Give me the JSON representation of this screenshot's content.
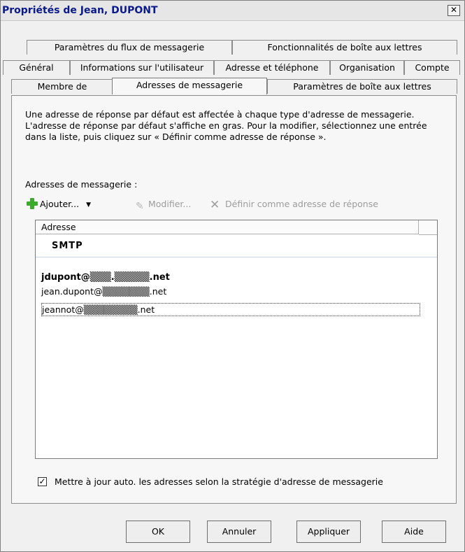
{
  "window": {
    "title": "Propriétés de Jean, DUPONT",
    "close": "✕"
  },
  "tabs": {
    "row1": [
      "Paramètres du flux de messagerie",
      "Fonctionnalités de boîte aux lettres"
    ],
    "row2": [
      "Général",
      "Informations sur l'utilisateur",
      "Adresse et téléphone",
      "Organisation",
      "Compte"
    ],
    "row3": [
      "Membre de",
      "Adresses de messagerie",
      "Paramètres de boîte aux lettres"
    ],
    "active": "Adresses de messagerie"
  },
  "content": {
    "info_text": "Une adresse de réponse par défaut est affectée à chaque type d'adresse de messagerie. L'adresse de réponse par défaut s'affiche en gras. Pour la modifier, sélectionnez une entrée dans la liste, puis cliquez sur « Définir comme adresse de réponse ».",
    "addresses_label": "Adresses de messagerie :",
    "toolbar": {
      "add": "Ajouter...",
      "edit": "Modifier...",
      "set_reply": "Définir comme adresse de réponse"
    },
    "list": {
      "column_header": "Adresse",
      "group": "SMTP",
      "rows": [
        "jdupont@▒▒▒.▒▒▒▒▒.net",
        "jean.dupont@▒▒▒▒▒▒▒.net",
        "jeannot@▒▒▒▒▒▒▒▒.net"
      ]
    },
    "checkbox": {
      "checked": true,
      "mark": "✓",
      "label": "Mettre à jour auto. les adresses selon la stratégie d'adresse de messagerie"
    }
  },
  "buttons": {
    "ok": "OK",
    "cancel": "Annuler",
    "apply": "Appliquer",
    "help": "Aide"
  }
}
